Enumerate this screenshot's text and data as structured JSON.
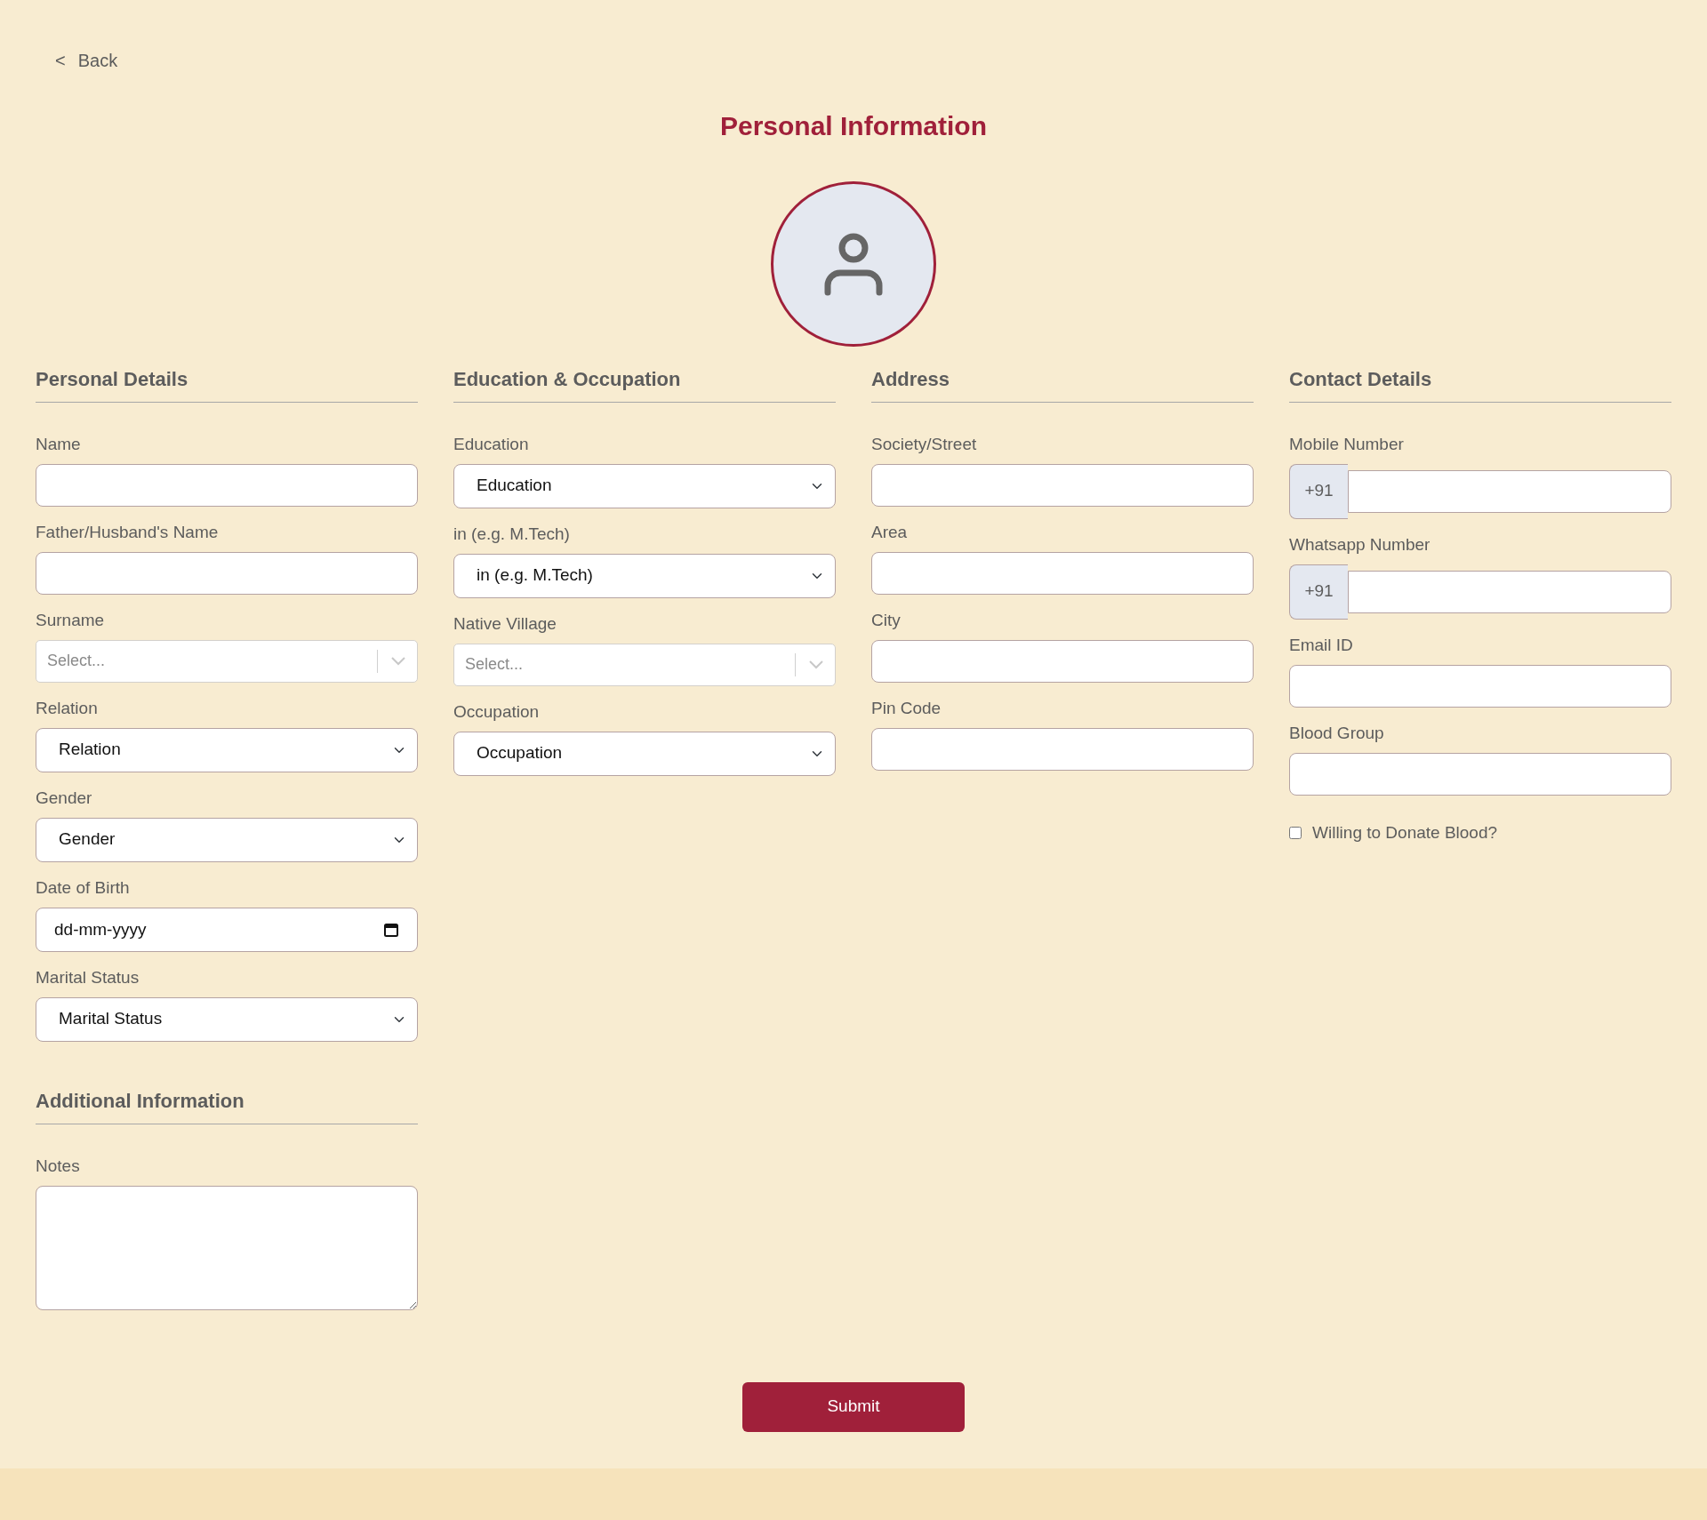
{
  "back": {
    "icon": "<",
    "label": "Back"
  },
  "title": "Personal Information",
  "columns": [
    {
      "sections": [
        {
          "title": "Personal Details",
          "fields": [
            {
              "kind": "text",
              "label": "Name"
            },
            {
              "kind": "text",
              "label": "Father/Husband's Name"
            },
            {
              "kind": "combo",
              "label": "Surname",
              "placeholder": "Select..."
            },
            {
              "kind": "select",
              "label": "Relation",
              "value": "Relation"
            },
            {
              "kind": "select",
              "label": "Gender",
              "value": "Gender"
            },
            {
              "kind": "date",
              "label": "Date of Birth",
              "value": "dd-mm-yyyy"
            },
            {
              "kind": "select",
              "label": "Marital Status",
              "value": "Marital Status"
            }
          ]
        },
        {
          "title": "Additional Information",
          "fields": [
            {
              "kind": "textarea",
              "label": "Notes"
            }
          ]
        }
      ]
    },
    {
      "sections": [
        {
          "title": "Education & Occupation",
          "fields": [
            {
              "kind": "select",
              "label": "Education",
              "value": "Education"
            },
            {
              "kind": "select",
              "label": "in (e.g. M.Tech)",
              "value": "in (e.g. M.Tech)"
            },
            {
              "kind": "combo",
              "label": "Native Village",
              "placeholder": "Select..."
            },
            {
              "kind": "select",
              "label": "Occupation",
              "value": "Occupation"
            }
          ]
        }
      ]
    },
    {
      "sections": [
        {
          "title": "Address",
          "fields": [
            {
              "kind": "text",
              "label": "Society/Street"
            },
            {
              "kind": "text",
              "label": "Area"
            },
            {
              "kind": "text",
              "label": "City"
            },
            {
              "kind": "text",
              "label": "Pin Code"
            }
          ]
        }
      ]
    },
    {
      "sections": [
        {
          "title": "Contact Details",
          "fields": [
            {
              "kind": "phone",
              "label": "Mobile Number",
              "prefix": "+91"
            },
            {
              "kind": "phone",
              "label": "Whatsapp Number",
              "prefix": "+91"
            },
            {
              "kind": "text",
              "label": "Email ID"
            },
            {
              "kind": "text",
              "label": "Blood Group"
            },
            {
              "kind": "checkbox",
              "label": "Willing to Donate Blood?",
              "checked": false
            }
          ]
        }
      ]
    }
  ],
  "submit": "Submit"
}
